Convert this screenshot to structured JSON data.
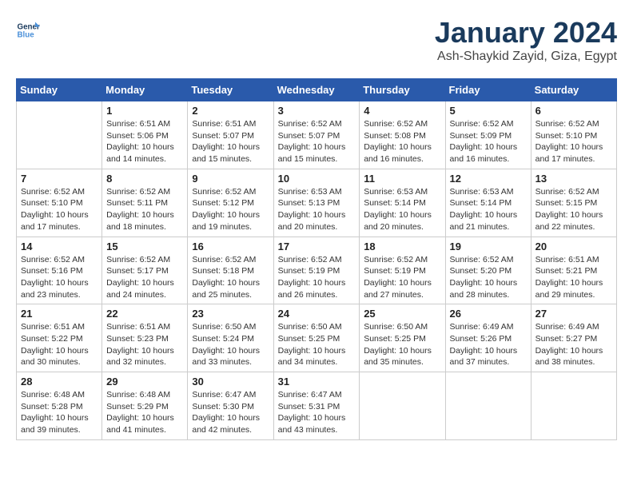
{
  "logo": {
    "line1": "General",
    "line2": "Blue"
  },
  "header": {
    "month": "January 2024",
    "location": "Ash-Shaykid Zayid, Giza, Egypt"
  },
  "days_of_week": [
    "Sunday",
    "Monday",
    "Tuesday",
    "Wednesday",
    "Thursday",
    "Friday",
    "Saturday"
  ],
  "weeks": [
    [
      {
        "day": "",
        "sunrise": "",
        "sunset": "",
        "daylight": ""
      },
      {
        "day": "1",
        "sunrise": "Sunrise: 6:51 AM",
        "sunset": "Sunset: 5:06 PM",
        "daylight": "Daylight: 10 hours and 14 minutes."
      },
      {
        "day": "2",
        "sunrise": "Sunrise: 6:51 AM",
        "sunset": "Sunset: 5:07 PM",
        "daylight": "Daylight: 10 hours and 15 minutes."
      },
      {
        "day": "3",
        "sunrise": "Sunrise: 6:52 AM",
        "sunset": "Sunset: 5:07 PM",
        "daylight": "Daylight: 10 hours and 15 minutes."
      },
      {
        "day": "4",
        "sunrise": "Sunrise: 6:52 AM",
        "sunset": "Sunset: 5:08 PM",
        "daylight": "Daylight: 10 hours and 16 minutes."
      },
      {
        "day": "5",
        "sunrise": "Sunrise: 6:52 AM",
        "sunset": "Sunset: 5:09 PM",
        "daylight": "Daylight: 10 hours and 16 minutes."
      },
      {
        "day": "6",
        "sunrise": "Sunrise: 6:52 AM",
        "sunset": "Sunset: 5:10 PM",
        "daylight": "Daylight: 10 hours and 17 minutes."
      }
    ],
    [
      {
        "day": "7",
        "sunrise": "Sunrise: 6:52 AM",
        "sunset": "Sunset: 5:10 PM",
        "daylight": "Daylight: 10 hours and 17 minutes."
      },
      {
        "day": "8",
        "sunrise": "Sunrise: 6:52 AM",
        "sunset": "Sunset: 5:11 PM",
        "daylight": "Daylight: 10 hours and 18 minutes."
      },
      {
        "day": "9",
        "sunrise": "Sunrise: 6:52 AM",
        "sunset": "Sunset: 5:12 PM",
        "daylight": "Daylight: 10 hours and 19 minutes."
      },
      {
        "day": "10",
        "sunrise": "Sunrise: 6:53 AM",
        "sunset": "Sunset: 5:13 PM",
        "daylight": "Daylight: 10 hours and 20 minutes."
      },
      {
        "day": "11",
        "sunrise": "Sunrise: 6:53 AM",
        "sunset": "Sunset: 5:14 PM",
        "daylight": "Daylight: 10 hours and 20 minutes."
      },
      {
        "day": "12",
        "sunrise": "Sunrise: 6:53 AM",
        "sunset": "Sunset: 5:14 PM",
        "daylight": "Daylight: 10 hours and 21 minutes."
      },
      {
        "day": "13",
        "sunrise": "Sunrise: 6:52 AM",
        "sunset": "Sunset: 5:15 PM",
        "daylight": "Daylight: 10 hours and 22 minutes."
      }
    ],
    [
      {
        "day": "14",
        "sunrise": "Sunrise: 6:52 AM",
        "sunset": "Sunset: 5:16 PM",
        "daylight": "Daylight: 10 hours and 23 minutes."
      },
      {
        "day": "15",
        "sunrise": "Sunrise: 6:52 AM",
        "sunset": "Sunset: 5:17 PM",
        "daylight": "Daylight: 10 hours and 24 minutes."
      },
      {
        "day": "16",
        "sunrise": "Sunrise: 6:52 AM",
        "sunset": "Sunset: 5:18 PM",
        "daylight": "Daylight: 10 hours and 25 minutes."
      },
      {
        "day": "17",
        "sunrise": "Sunrise: 6:52 AM",
        "sunset": "Sunset: 5:19 PM",
        "daylight": "Daylight: 10 hours and 26 minutes."
      },
      {
        "day": "18",
        "sunrise": "Sunrise: 6:52 AM",
        "sunset": "Sunset: 5:19 PM",
        "daylight": "Daylight: 10 hours and 27 minutes."
      },
      {
        "day": "19",
        "sunrise": "Sunrise: 6:52 AM",
        "sunset": "Sunset: 5:20 PM",
        "daylight": "Daylight: 10 hours and 28 minutes."
      },
      {
        "day": "20",
        "sunrise": "Sunrise: 6:51 AM",
        "sunset": "Sunset: 5:21 PM",
        "daylight": "Daylight: 10 hours and 29 minutes."
      }
    ],
    [
      {
        "day": "21",
        "sunrise": "Sunrise: 6:51 AM",
        "sunset": "Sunset: 5:22 PM",
        "daylight": "Daylight: 10 hours and 30 minutes."
      },
      {
        "day": "22",
        "sunrise": "Sunrise: 6:51 AM",
        "sunset": "Sunset: 5:23 PM",
        "daylight": "Daylight: 10 hours and 32 minutes."
      },
      {
        "day": "23",
        "sunrise": "Sunrise: 6:50 AM",
        "sunset": "Sunset: 5:24 PM",
        "daylight": "Daylight: 10 hours and 33 minutes."
      },
      {
        "day": "24",
        "sunrise": "Sunrise: 6:50 AM",
        "sunset": "Sunset: 5:25 PM",
        "daylight": "Daylight: 10 hours and 34 minutes."
      },
      {
        "day": "25",
        "sunrise": "Sunrise: 6:50 AM",
        "sunset": "Sunset: 5:25 PM",
        "daylight": "Daylight: 10 hours and 35 minutes."
      },
      {
        "day": "26",
        "sunrise": "Sunrise: 6:49 AM",
        "sunset": "Sunset: 5:26 PM",
        "daylight": "Daylight: 10 hours and 37 minutes."
      },
      {
        "day": "27",
        "sunrise": "Sunrise: 6:49 AM",
        "sunset": "Sunset: 5:27 PM",
        "daylight": "Daylight: 10 hours and 38 minutes."
      }
    ],
    [
      {
        "day": "28",
        "sunrise": "Sunrise: 6:48 AM",
        "sunset": "Sunset: 5:28 PM",
        "daylight": "Daylight: 10 hours and 39 minutes."
      },
      {
        "day": "29",
        "sunrise": "Sunrise: 6:48 AM",
        "sunset": "Sunset: 5:29 PM",
        "daylight": "Daylight: 10 hours and 41 minutes."
      },
      {
        "day": "30",
        "sunrise": "Sunrise: 6:47 AM",
        "sunset": "Sunset: 5:30 PM",
        "daylight": "Daylight: 10 hours and 42 minutes."
      },
      {
        "day": "31",
        "sunrise": "Sunrise: 6:47 AM",
        "sunset": "Sunset: 5:31 PM",
        "daylight": "Daylight: 10 hours and 43 minutes."
      },
      {
        "day": "",
        "sunrise": "",
        "sunset": "",
        "daylight": ""
      },
      {
        "day": "",
        "sunrise": "",
        "sunset": "",
        "daylight": ""
      },
      {
        "day": "",
        "sunrise": "",
        "sunset": "",
        "daylight": ""
      }
    ]
  ]
}
